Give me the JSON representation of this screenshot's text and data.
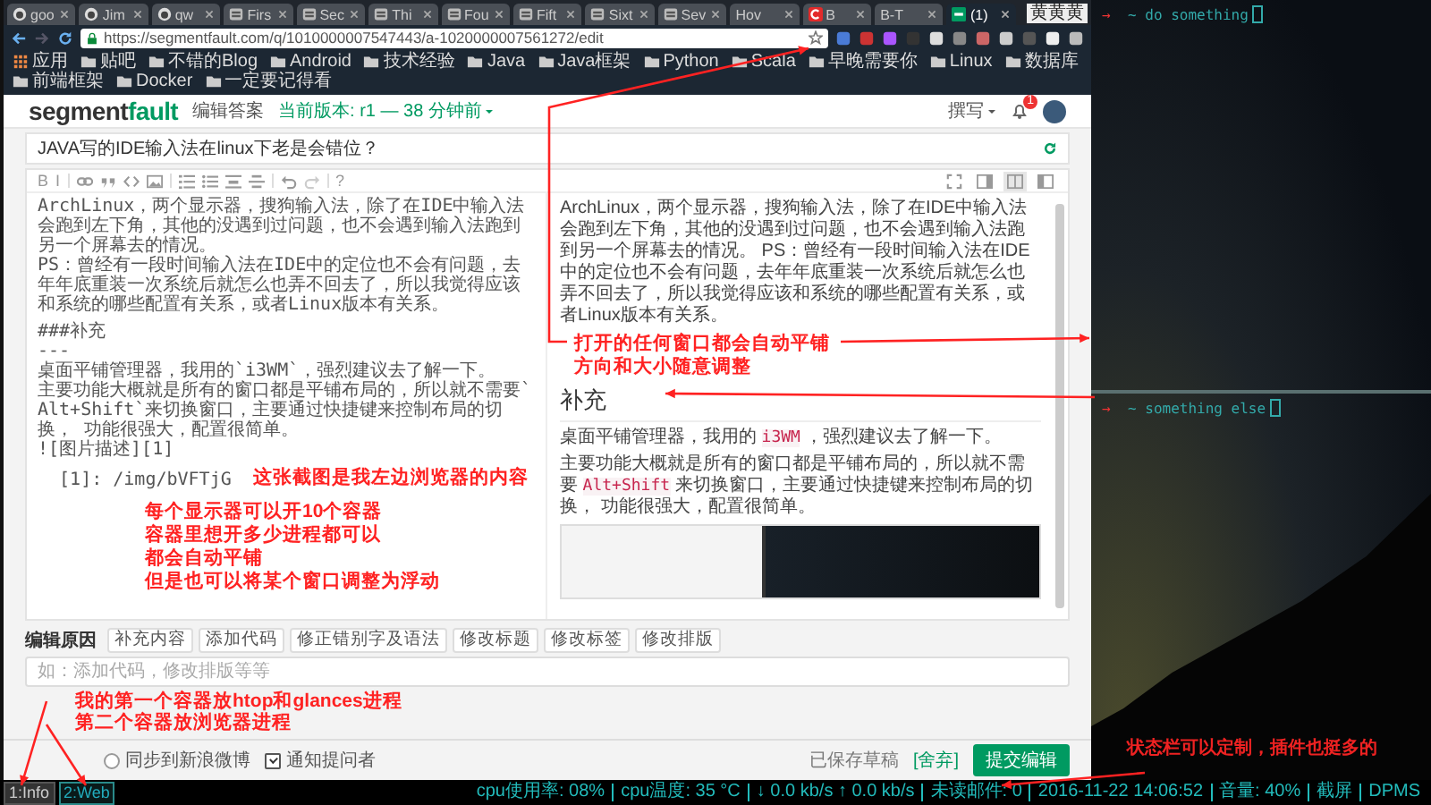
{
  "browser": {
    "tabs": [
      {
        "label": "goo",
        "kind": "github",
        "selected": false
      },
      {
        "label": "Jim",
        "kind": "github",
        "selected": false
      },
      {
        "label": "qw",
        "kind": "github",
        "selected": false
      },
      {
        "label": "Firs",
        "kind": "site",
        "selected": false
      },
      {
        "label": "Sec",
        "kind": "site",
        "selected": false
      },
      {
        "label": "Thi",
        "kind": "site",
        "selected": false
      },
      {
        "label": "Fou",
        "kind": "site",
        "selected": false
      },
      {
        "label": "Fift",
        "kind": "site",
        "selected": false
      },
      {
        "label": "Sixt",
        "kind": "site",
        "selected": false
      },
      {
        "label": "Sev",
        "kind": "site",
        "selected": false
      },
      {
        "label": "Hov",
        "kind": "blank",
        "selected": false
      },
      {
        "label": "B",
        "kind": "letter",
        "selected": false
      },
      {
        "label": "B-T",
        "kind": "blank",
        "selected": false
      },
      {
        "label": "(1)",
        "kind": "brand",
        "selected": true
      }
    ],
    "profile": "黄黄黄",
    "url": "https://segmentfault.com/q/1010000007547443/a-1020000007561272/edit",
    "bookmarks": [
      {
        "label": "应用",
        "kind": "apps"
      },
      {
        "label": "贴吧",
        "kind": "folder"
      },
      {
        "label": "不错的Blog",
        "kind": "folder"
      },
      {
        "label": "Android",
        "kind": "folder"
      },
      {
        "label": "技术经验",
        "kind": "folder"
      },
      {
        "label": "Java",
        "kind": "folder"
      },
      {
        "label": "Java框架",
        "kind": "folder"
      },
      {
        "label": "Python",
        "kind": "folder"
      },
      {
        "label": "Scala",
        "kind": "folder"
      },
      {
        "label": "早晚需要你",
        "kind": "folder"
      },
      {
        "label": "Linux",
        "kind": "folder"
      },
      {
        "label": "数据库",
        "kind": "folder"
      },
      {
        "label": "前端框架",
        "kind": "folder"
      },
      {
        "label": "Docker",
        "kind": "folder"
      },
      {
        "label": "一定要记得看",
        "kind": "folder"
      }
    ]
  },
  "site": {
    "logo": {
      "text": "segment",
      "accent": "fault"
    },
    "page_title": "编辑答案",
    "version": "当前版本: r1 — 38 分钟前",
    "write": "撰写",
    "notifications": "1"
  },
  "question_title": "JAVA写的IDE输入法在linux下老是会错位？",
  "editor": {
    "toolbar": [
      {
        "kind": "text",
        "label": "B"
      },
      {
        "kind": "text",
        "label": "I"
      },
      {
        "kind": "separator"
      },
      {
        "kind": "link"
      },
      {
        "kind": "quote"
      },
      {
        "kind": "code"
      },
      {
        "kind": "image"
      },
      {
        "kind": "separator"
      },
      {
        "kind": "ordered"
      },
      {
        "kind": "bullets"
      },
      {
        "kind": "align"
      },
      {
        "kind": "rule"
      },
      {
        "kind": "separator"
      },
      {
        "kind": "undo"
      },
      {
        "kind": "redo"
      },
      {
        "kind": "separator"
      },
      {
        "kind": "text",
        "label": "?"
      }
    ],
    "view_modes": [
      {
        "kind": "fullscreen",
        "selected": false
      },
      {
        "kind": "editor",
        "selected": false
      },
      {
        "kind": "split",
        "selected": true
      },
      {
        "kind": "preview",
        "selected": false
      }
    ],
    "source_blocks": [
      [
        "ArchLinux，两个显示器，搜狗输入法，除了在IDE中输入法会跑到左下角，其他的没遇到过问题，也不会遇到输入法跑到另一个屏幕去的情况。",
        "PS：曾经有一段时间输入法在IDE中的定位也不会有问题，去年年底重装一次系统后就怎么也弄不回去了，所以我觉得应该和系统的哪些配置有关系，或者Linux版本有关系。"
      ],
      [
        "###补充",
        "---",
        "桌面平铺管理器，我用的`i3WM`，强烈建议去了解一下。",
        "主要功能大概就是所有的窗口都是平铺布局的，所以就不需要`Alt+Shift`来切换窗口，主要通过快捷键来控制布局的切换， 功能很强大，配置很简单。",
        "![图片描述][1]"
      ],
      [
        "  [1]: /img/bVFTjG"
      ]
    ],
    "preview": {
      "intro": "ArchLinux，两个显示器，搜狗输入法，除了在IDE中输入法会跑到左下角，其他的没遇到过问题，也不会遇到输入法跑到另一个屏幕去的情况。 PS：曾经有一段时间输入法在IDE中的定位也不会有问题，去年年底重装一次系统后就怎么也弄不回去了，所以我觉得应该和系统的哪些配置有关系，或者Linux版本有关系。",
      "heading": "补充",
      "lines": [
        [
          {
            "kind": "text",
            "text": "桌面平铺管理器，我用的 "
          },
          {
            "kind": "code",
            "text": "i3WM"
          },
          {
            "kind": "text",
            "text": " ，强烈建议去了解一下。"
          }
        ],
        [
          {
            "kind": "text",
            "text": "主要功能大概就是所有的窗口都是平铺布局的，所以就不需要 "
          },
          {
            "kind": "code",
            "text": "Alt+Shift"
          },
          {
            "kind": "text",
            "text": " 来切换窗口，主要通过快捷键来控制布局的切换， 功能很强大，配置很简单。"
          }
        ]
      ]
    }
  },
  "edit_reason": {
    "label": "编辑原因",
    "options": [
      "补充内容",
      "添加代码",
      "修正错别字及语法",
      "修改标题",
      "修改标签",
      "修改排版"
    ],
    "placeholder": "如：添加代码，修改排版等等"
  },
  "footer": {
    "checkboxes": [
      {
        "label": "同步到新浪微博",
        "checked": false
      },
      {
        "label": "通知提问者",
        "checked": true
      }
    ],
    "draft": "已保存草稿",
    "discard": "[舍弃]",
    "submit": "提交编辑"
  },
  "terminals": [
    {
      "prompt": "→",
      "cwd": "~",
      "command": "do something"
    },
    {
      "prompt": "→",
      "cwd": "~",
      "command": "something else"
    }
  ],
  "status_bar": {
    "workspaces": [
      {
        "label": "1:Info",
        "selected": false
      },
      {
        "label": "2:Web",
        "selected": true
      }
    ],
    "items": [
      "cpu使用率: 08%",
      "cpu温度: 35 °C",
      "↓ 0.0 kb/s ↑ 0.0 kb/s",
      "未读邮件: 0",
      "2016-11-22 14:06:52",
      "音量: 40%",
      "截屏",
      "DPMS"
    ]
  },
  "annotations": {
    "source": [
      [
        "这张截图是我左边浏览器的内容"
      ],
      [
        "每个显示器可以开10个容器",
        "容器里想开多少进程都可以",
        "都会自动平铺",
        "但是也可以将某个窗口调整为浮动"
      ]
    ],
    "preview": [
      "打开的任何窗口都会自动平铺",
      "方向和大小随意调整"
    ],
    "container_one": "我的第一个容器放htop和glances进程",
    "container_two": "第二个容器放浏览器进程",
    "status_bar": "状态栏可以定制，插件也挺多的"
  }
}
